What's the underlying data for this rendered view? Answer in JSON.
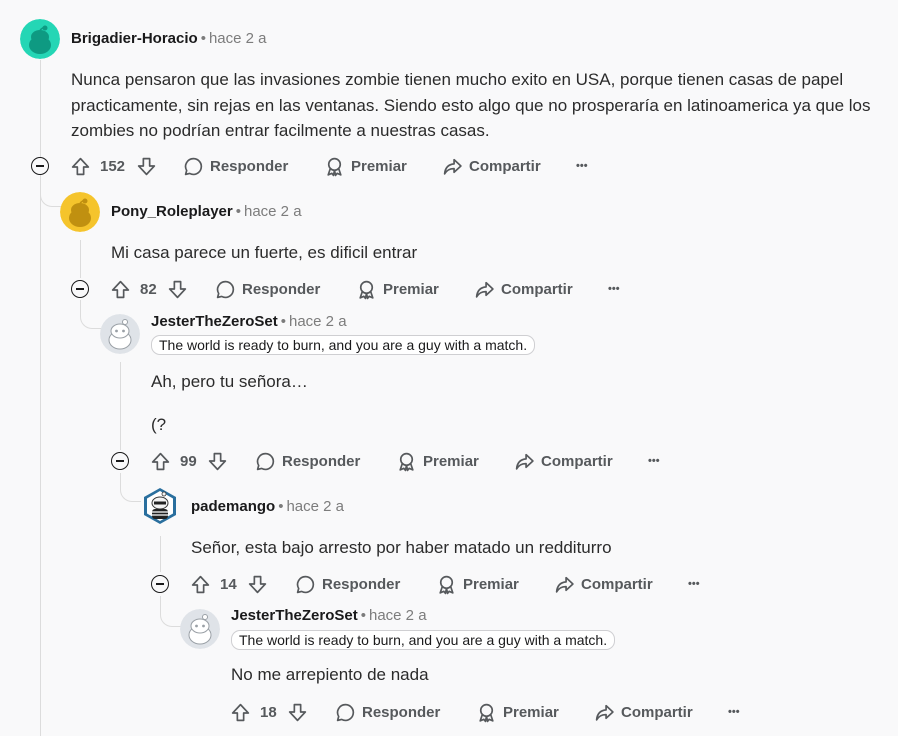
{
  "comments": [
    {
      "author": "Brigadier-Horacio",
      "time": "hace 2 a",
      "body": "Nunca pensaron que las invasiones zombie tienen mucho exito en USA, porque tienen casas de papel practicamente, sin rejas en las ventanas. Siendo esto algo que no prosperaría en latinoamerica ya que los zombies no podrían entrar facilmente a nuestras casas.",
      "votes": "152"
    },
    {
      "author": "Pony_Roleplayer",
      "time": "hace 2 a",
      "body": "Mi casa parece un fuerte, es dificil entrar",
      "votes": "82"
    },
    {
      "author": "JesterTheZeroSet",
      "time": "hace 2 a",
      "flair": "The world is ready to burn, and you are a guy with a match.",
      "body": "Ah, pero tu señora…",
      "body2": "(?",
      "votes": "99"
    },
    {
      "author": "pademango",
      "time": "hace 2 a",
      "body": "Señor, esta bajo arresto por haber matado un redditurro",
      "votes": "14"
    },
    {
      "author": "JesterTheZeroSet",
      "time": "hace 2 a",
      "flair": "The world is ready to burn, and you are a guy with a match.",
      "body": "No me arrepiento de nada",
      "votes": "18"
    }
  ],
  "actions": {
    "reply": "Responder",
    "award": "Premiar",
    "share": "Compartir",
    "more": "•••"
  },
  "colors": {
    "avatar1": "#24d6b5",
    "avatar2": "#f5c42c",
    "background": "#f9f9fa",
    "text": "#1a1a1b",
    "muted": "#7c7c7c"
  }
}
